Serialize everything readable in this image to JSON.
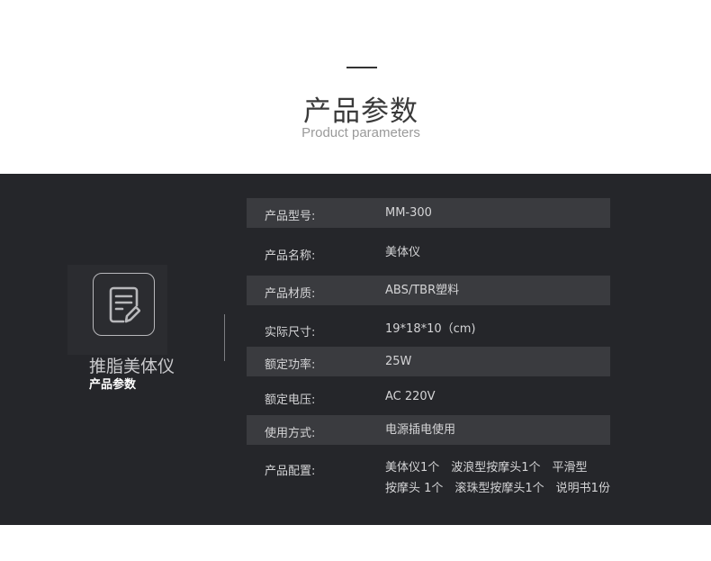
{
  "header": {
    "title": "产品参数",
    "subtitle": "Product parameters"
  },
  "product": {
    "name": "推脂美体仪",
    "subtitle": "产品参数",
    "icon": "document-edit-icon"
  },
  "specs": [
    {
      "label": "产品型号:",
      "value": "MM-300",
      "shaded": true
    },
    {
      "label": "产品名称:",
      "value": "美体仪",
      "shaded": false
    },
    {
      "label": "产品材质:",
      "value": "ABS/TBR塑料",
      "shaded": true
    },
    {
      "label": "实际尺寸:",
      "value": "19*18*10（cm)",
      "shaded": false
    },
    {
      "label": "额定功率:",
      "value": "25W",
      "shaded": true
    },
    {
      "label": "额定电压:",
      "value": "AC 220V",
      "shaded": false
    },
    {
      "label": "使用方式:",
      "value": "电源插电使用",
      "shaded": true
    },
    {
      "label": "产品配置:",
      "value_lines": [
        "美体仪1个　波浪型按摩头1个　平滑型",
        "按摩头 1个　滚珠型按摩头1个　说明书1份"
      ],
      "shaded": false
    }
  ],
  "colors": {
    "panel": "#25262a",
    "row_shade": "#3a3b3f",
    "text_light": "#d4d4d6"
  }
}
